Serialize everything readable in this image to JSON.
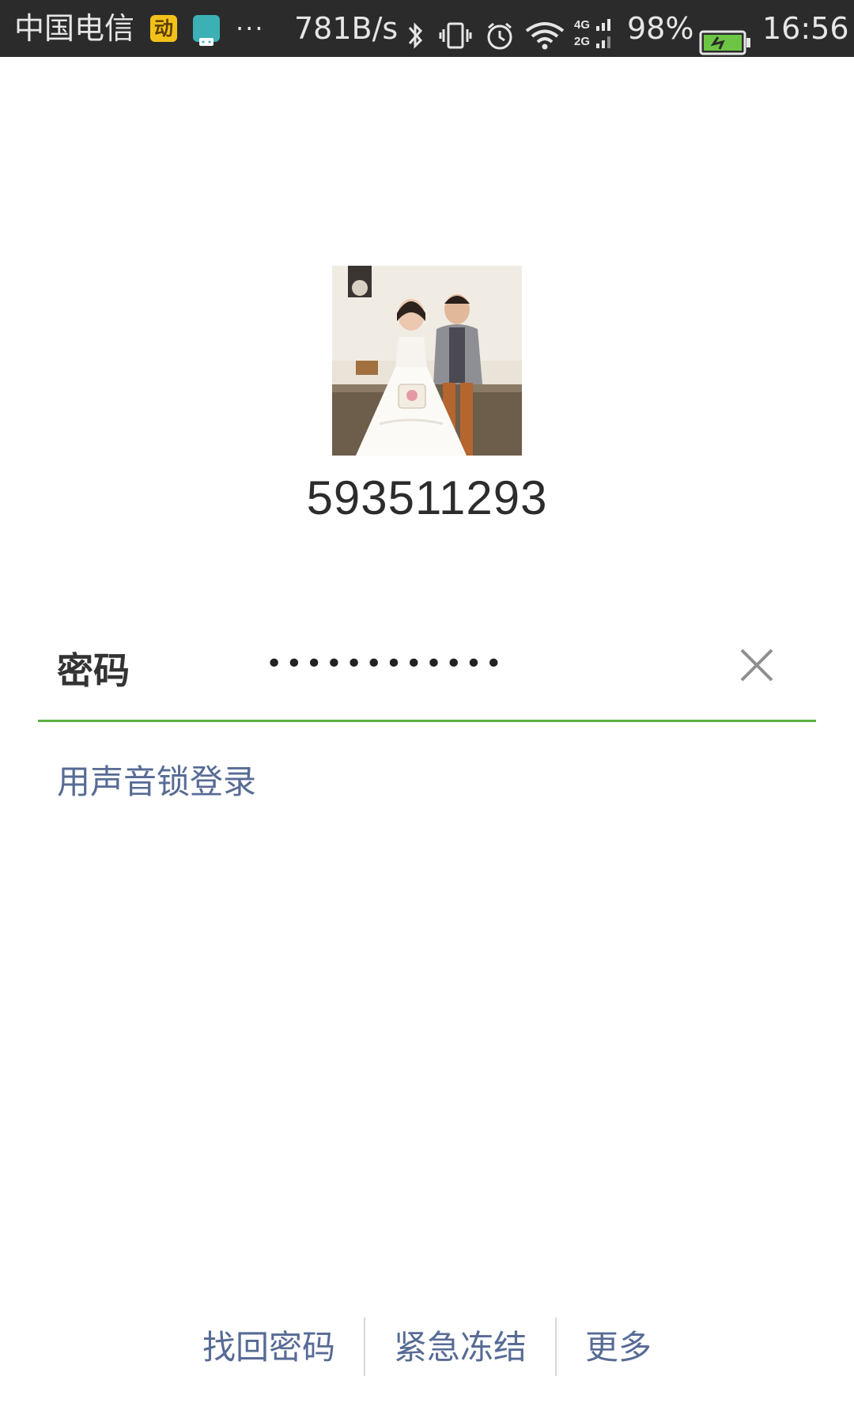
{
  "status_bar": {
    "carrier": "中国电信",
    "app_badge": "动",
    "more": "···",
    "net_speed": "781B/s",
    "network": "4G 2G",
    "battery_pct": "98%",
    "time": "16:56",
    "icons": [
      "bluetooth-icon",
      "vibrate-icon",
      "alarm-icon",
      "wifi-icon",
      "signal-icon",
      "battery-icon"
    ]
  },
  "login": {
    "account": "593511293",
    "password_label": "密码",
    "password_mask": "••••••••••••",
    "voice_lock_login": "用声音锁登录"
  },
  "footer": {
    "links": [
      "找回密码",
      "紧急冻结",
      "更多"
    ]
  },
  "colors": {
    "accent_green": "#5cb044",
    "link_blue": "#576b95",
    "status_bar_bg": "#2b2b2b"
  }
}
